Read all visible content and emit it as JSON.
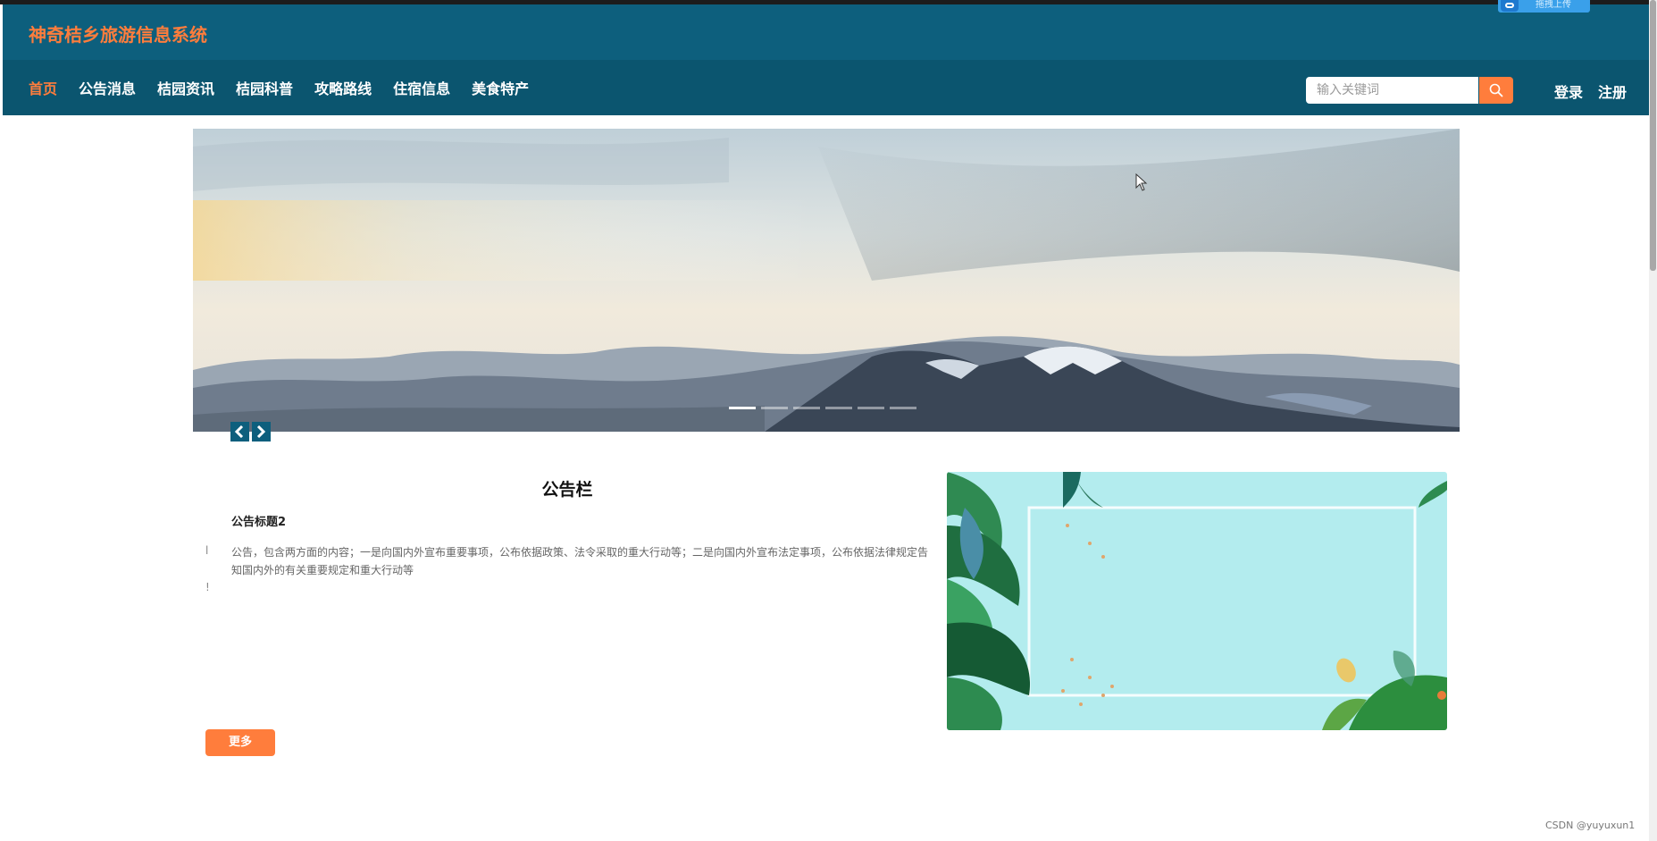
{
  "header": {
    "title": "神奇桔乡旅游信息系统",
    "upload_badge": "拖拽上传"
  },
  "nav": {
    "items": [
      {
        "label": "首页",
        "active": true
      },
      {
        "label": "公告消息",
        "active": false
      },
      {
        "label": "桔园资讯",
        "active": false
      },
      {
        "label": "桔园科普",
        "active": false
      },
      {
        "label": "攻略路线",
        "active": false
      },
      {
        "label": "住宿信息",
        "active": false
      },
      {
        "label": "美食特产",
        "active": false
      }
    ],
    "search": {
      "placeholder": "输入关键词",
      "value": "",
      "button_icon": "search-icon"
    },
    "login": "登录",
    "register": "注册"
  },
  "carousel": {
    "slide_count": 6,
    "active_index": 0,
    "prev_icon": "chevron-left-icon",
    "next_icon": "chevron-right-icon"
  },
  "notice": {
    "section_title": "公告栏",
    "item_title": "公告标题2",
    "item_content": "公告，包含两方面的内容；一是向国内外宣布重要事项，公布依据政策、法令采取的重大行动等；二是向国内外宣布法定事项，公布依据法律规定告知国内外的有关重要规定和重大行动等",
    "more_label": "更多",
    "side_marks": [
      "l",
      "!"
    ]
  },
  "watermark": "CSDN @yuyuxun1",
  "colors": {
    "header_bg": "#0d5f7d",
    "nav_bg": "#0b556f",
    "accent": "#ff7d3c",
    "text_white": "#ffffff"
  }
}
